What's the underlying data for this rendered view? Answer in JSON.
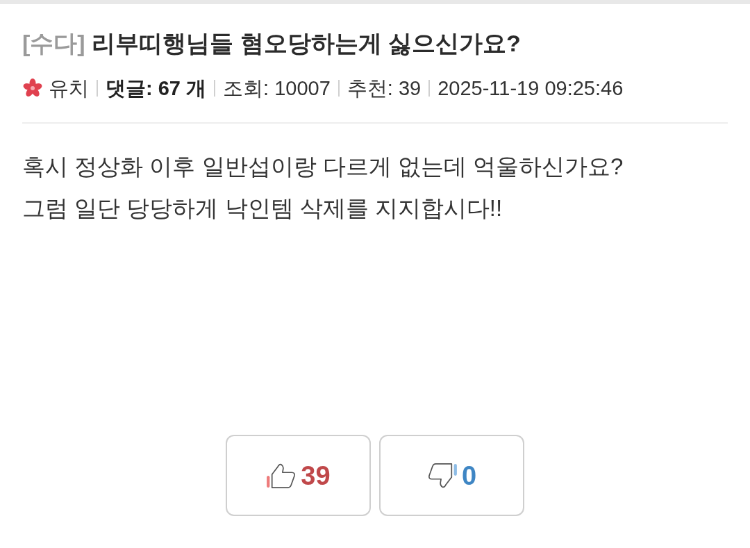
{
  "post": {
    "category": "[수다]",
    "title": "리부띠행님들 혐오당하는게 싫으신가요?",
    "meta": [
      {
        "kind": "author",
        "text": "유치"
      },
      {
        "kind": "comments",
        "text": "댓글: 67 개"
      },
      {
        "kind": "stat",
        "text": "조회: 10007"
      },
      {
        "kind": "stat",
        "text": "추천: 39"
      },
      {
        "kind": "stat",
        "text": "2025-11-19 09:25:46"
      }
    ],
    "body": [
      "혹시 정상화 이후 일반섭이랑 다르게 없는데 억울하신가요?",
      "그럼 일단 당당하게 낙인템 삭제를 지지합시다!!"
    ],
    "votes": [
      {
        "kind": "up",
        "count": "39"
      },
      {
        "kind": "down",
        "count": "0"
      }
    ]
  }
}
